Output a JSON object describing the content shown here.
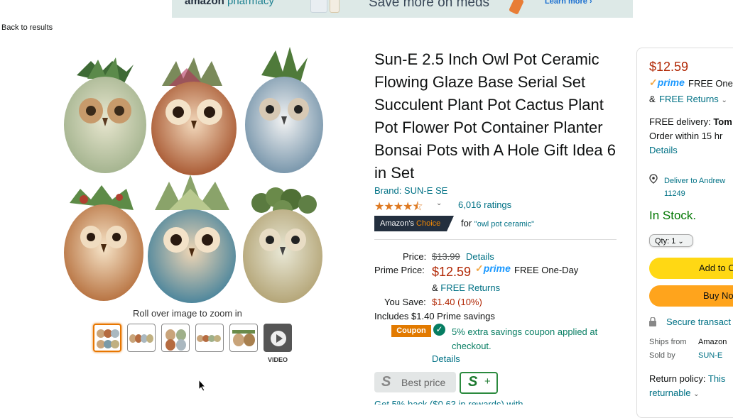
{
  "banner": {
    "brand": "amazon",
    "brand_suffix": "pharmacy",
    "headline": "Save more on meds",
    "cta": "Learn more ›"
  },
  "nav": {
    "back_label": "Back to results"
  },
  "gallery": {
    "zoom_hint": "Roll over image to zoom in",
    "video_label": "VIDEO"
  },
  "product": {
    "title": "Sun-E 2.5 Inch Owl Pot Ceramic Flowing Glaze Base Serial Set Succulent Plant Pot Cactus Plant Pot Flower Pot Container Planter Bonsai Pots with A Hole Gift Idea 6 in Set",
    "brand": "Brand: SUN-E SE",
    "stars": "★★★★⯪",
    "rating_value": 4.5,
    "ratings": "6,016 ratings",
    "choice_prefix": "Amazon's",
    "choice_suffix": "Choice",
    "choice_for": "for",
    "choice_keyword": "\"owl pot ceramic\""
  },
  "pricing": {
    "price_label": "Price:",
    "list_price": "$13.99",
    "details_label": "Details",
    "prime_label": "Prime Price:",
    "prime_price": "$12.59",
    "prime_badge": "prime",
    "one_day": "FREE One-Day",
    "amp": "&",
    "free_returns": "FREE Returns",
    "save_label": "You Save:",
    "save_value": "$1.40 (10%)",
    "includes": "Includes $1.40 Prime savings",
    "coupon_badge": "Coupon",
    "coupon_text": "5% extra savings coupon applied at checkout.",
    "coupon_details": "Details",
    "best_price": "Best price",
    "best_price_s": "S",
    "sbadge_s": "S",
    "sbadge_plus": "+"
  },
  "buybox": {
    "price": "$12.59",
    "prime_badge": "prime",
    "free_one": "FREE One",
    "amp": "&",
    "free_returns": "FREE Returns",
    "delivery_prefix": "FREE delivery:",
    "delivery_day": "Tom",
    "order_within": "Order within 15 hr",
    "details": "Details",
    "deliver_to_line1": "Deliver to Andrew",
    "deliver_to_line2": "11249",
    "stock": "In Stock.",
    "qty": "Qty: 1",
    "add_to_cart": "Add to C",
    "buy_now": "Buy No",
    "secure": "Secure transact",
    "ships_from_label": "Ships from",
    "ships_from_value": "Amazon",
    "sold_by_label": "Sold by",
    "sold_by_value": "SUN-E",
    "return_policy_label": "Return policy:",
    "return_policy_value": "This",
    "returnable": "returnable"
  },
  "below": {
    "partial": "Get 5% back ($0.63 in rewards) with ..."
  },
  "colors": {
    "price": "#b12704",
    "link": "#007185",
    "stock": "#007600",
    "add_to_cart": "#ffd814",
    "buy_now": "#ffa41c"
  }
}
